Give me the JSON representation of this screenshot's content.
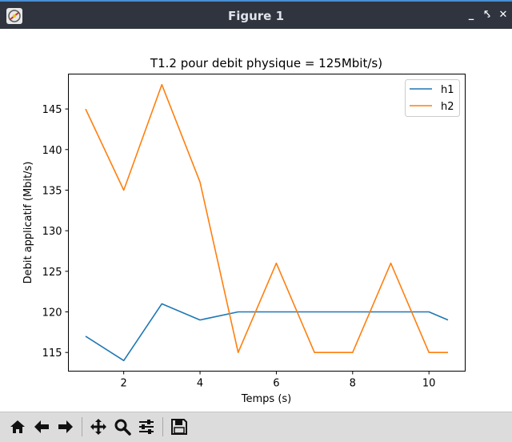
{
  "window": {
    "title": "Figure 1",
    "controls": [
      "_",
      "⤣",
      "✕"
    ]
  },
  "toolbar": {
    "buttons": [
      {
        "name": "home",
        "icon": "home-icon"
      },
      {
        "name": "back",
        "icon": "arrow-left-icon"
      },
      {
        "name": "forward",
        "icon": "arrow-right-icon"
      },
      {
        "name": "pan",
        "icon": "move-icon"
      },
      {
        "name": "zoom",
        "icon": "magnifier-icon"
      },
      {
        "name": "configure-subplots",
        "icon": "sliders-icon"
      },
      {
        "name": "save",
        "icon": "floppy-disk-icon"
      }
    ]
  },
  "chart_data": {
    "type": "line",
    "title": "T1.2 pour debit physique = 125Mbit/s)",
    "xlabel": "Temps (s)",
    "ylabel": "Debit applicatif (Mbit/s)",
    "xlim": [
      0.55,
      10.95
    ],
    "ylim": [
      112.7,
      149.3
    ],
    "xticks": [
      2,
      4,
      6,
      8,
      10
    ],
    "yticks": [
      115,
      120,
      125,
      130,
      135,
      140,
      145
    ],
    "legend_position": "top-right",
    "grid": false,
    "x": [
      1,
      2,
      3,
      4,
      5,
      6,
      7,
      8,
      9,
      10,
      10.5
    ],
    "series": [
      {
        "name": "h1",
        "color": "#1f77b4",
        "values": [
          117,
          114,
          121,
          119,
          120,
          120,
          120,
          120,
          120,
          120,
          119
        ]
      },
      {
        "name": "h2",
        "color": "#ff7f0e",
        "values": [
          145,
          135,
          148,
          136,
          115,
          126,
          115,
          115,
          126,
          115,
          115
        ]
      }
    ]
  }
}
